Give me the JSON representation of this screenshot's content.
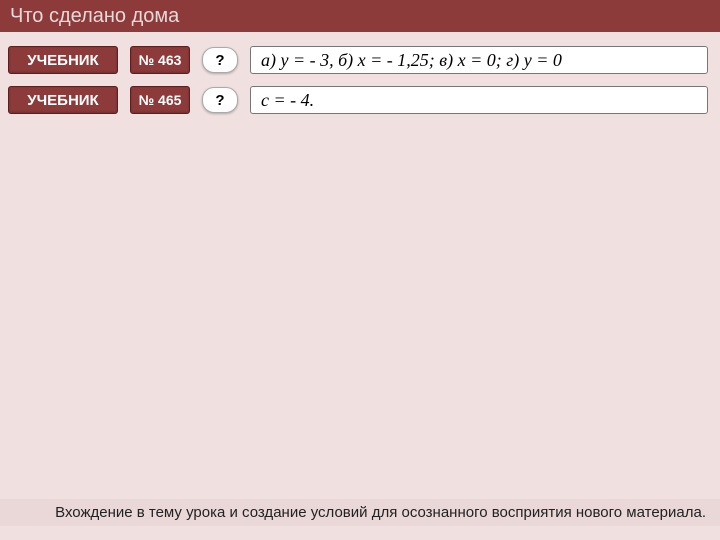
{
  "header": {
    "title": "Что  сделано  дома"
  },
  "rows": [
    {
      "textbook": "УЧЕБНИК",
      "num": "№ 463",
      "q": "?",
      "answer": "а) у = - 3, б) х = - 1,25; в) х = 0; г) у = 0"
    },
    {
      "textbook": "УЧЕБНИК",
      "num": "№ 465",
      "q": "?",
      "answer": "с = - 4."
    }
  ],
  "footer": {
    "text": "Вхождение в тему урока и создание условий для осознанного восприятия нового материала."
  }
}
